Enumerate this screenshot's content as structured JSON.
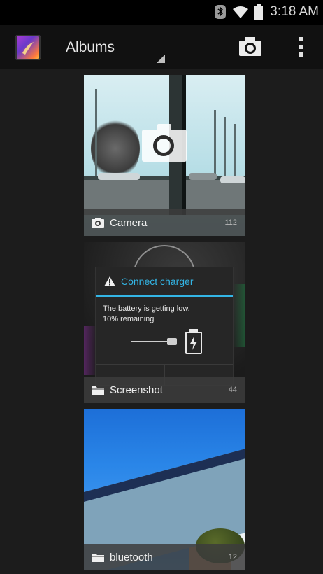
{
  "status_bar": {
    "time": "3:18 AM",
    "icons": [
      "bluetooth-icon",
      "wifi-icon",
      "battery-icon"
    ]
  },
  "action_bar": {
    "title": "Albums",
    "app_icon": "gallery-app-icon",
    "actions": [
      "camera-icon",
      "overflow-menu-icon"
    ]
  },
  "albums": [
    {
      "label": "Camera",
      "count": "112",
      "icon": "camera-icon"
    },
    {
      "label": "Screenshot",
      "count": "44",
      "icon": "folder-icon"
    },
    {
      "label": "bluetooth",
      "count": "12",
      "icon": "folder-icon"
    }
  ],
  "screenshot_thumb": {
    "dialog_title": "Connect charger",
    "dialog_body_line1": "The battery is getting low.",
    "dialog_body_line2": "10% remaining"
  },
  "colors": {
    "accent": "#33b5e5",
    "background": "#1c1c1c",
    "action_bar": "#111111"
  }
}
